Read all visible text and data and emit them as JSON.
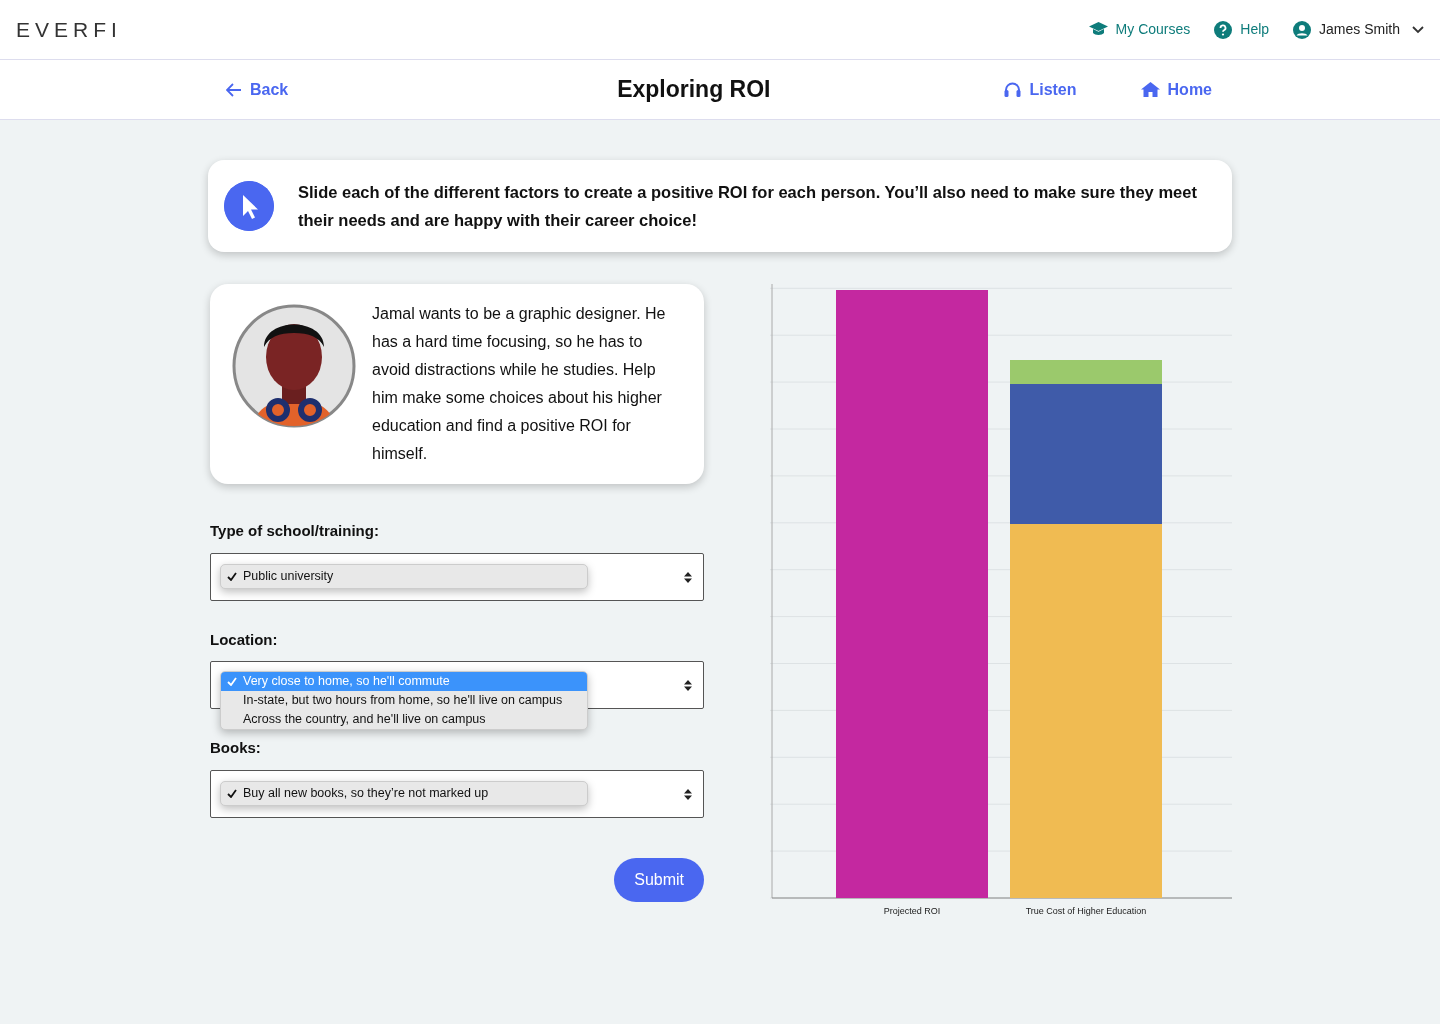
{
  "header": {
    "logo": "EVERFI",
    "nav": [
      {
        "label": "My Courses"
      },
      {
        "label": "Help"
      }
    ],
    "user": "James Smith"
  },
  "subnav": {
    "back": "Back",
    "title": "Exploring ROI",
    "actions": [
      {
        "label": "Listen"
      },
      {
        "label": "Home"
      }
    ]
  },
  "instruction": "Slide each of the different factors to create a positive ROI for each person. You’ll also need to make sure they meet their needs and are happy with their career choice!",
  "profile": {
    "text": "Jamal wants to be a graphic designer. He has a hard time focusing, so he has to avoid distractions while he studies. Help him make some choices about his higher education and find a positive ROI for himself."
  },
  "fields": [
    {
      "label": "Type of school/training:",
      "expanded": false,
      "options": [
        {
          "label": "Public university",
          "selected": true
        }
      ]
    },
    {
      "label": "Location:",
      "expanded": true,
      "options": [
        {
          "label": "Very close to home, so he'll commute",
          "selected": true
        },
        {
          "label": "In-state, but two hours from home, so he'll live on campus",
          "selected": false
        },
        {
          "label": "Across the country, and he'll live on campus",
          "selected": false
        }
      ]
    },
    {
      "label": "Books:",
      "expanded": false,
      "options": [
        {
          "label": "Buy all new books, so they’re not marked up",
          "selected": true
        }
      ]
    }
  ],
  "submit": "Submit",
  "chart": {
    "categories": [
      "Projected ROI",
      "True Cost of Higher Education"
    ]
  }
}
